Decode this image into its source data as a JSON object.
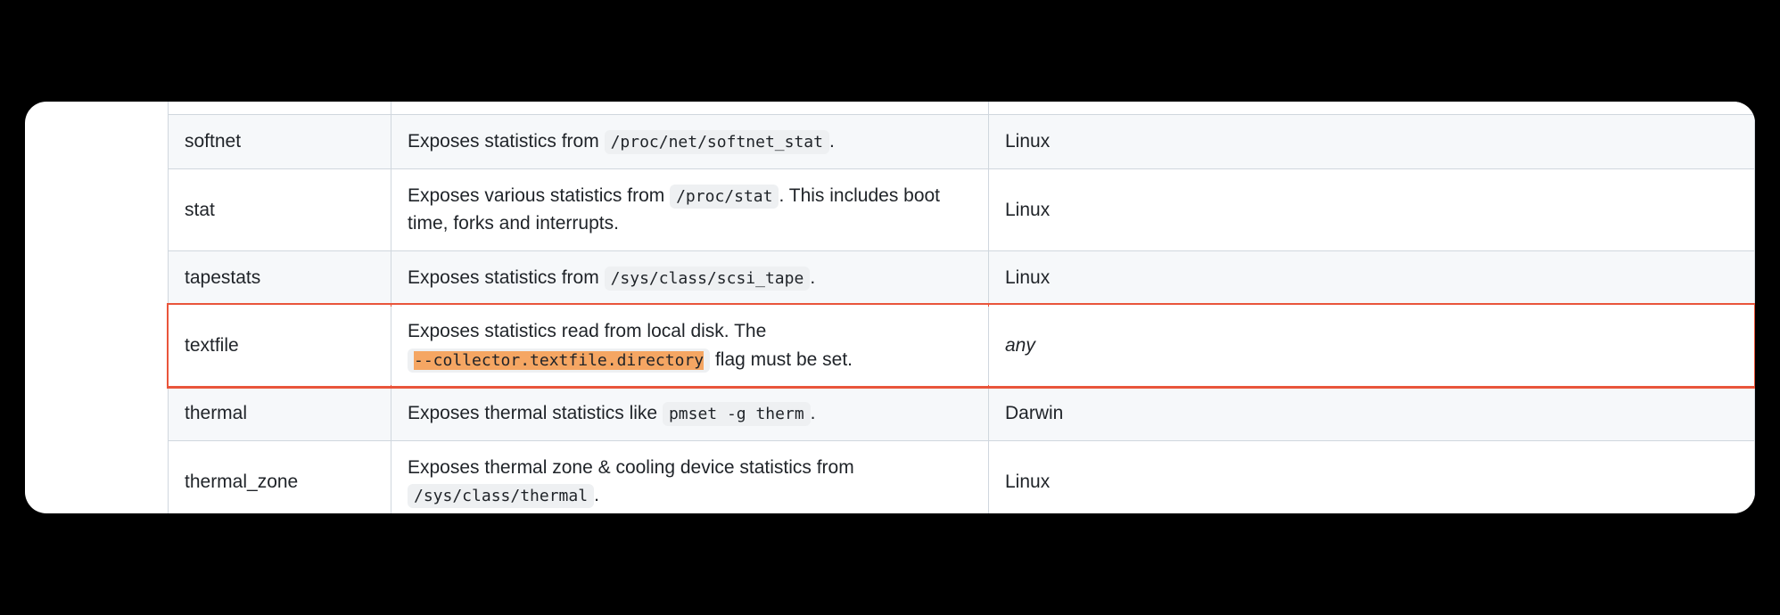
{
  "table": {
    "rows": [
      {
        "name": "softnet",
        "desc_prefix": "Exposes statistics from ",
        "code": "/proc/net/softnet_stat",
        "desc_suffix": ".",
        "os": "Linux"
      },
      {
        "name": "stat",
        "desc_prefix": "Exposes various statistics from ",
        "code": "/proc/stat",
        "desc_suffix": ". This includes boot time, forks and interrupts.",
        "os": "Linux"
      },
      {
        "name": "tapestats",
        "desc_prefix": "Exposes statistics from ",
        "code": "/sys/class/scsi_tape",
        "desc_suffix": ".",
        "os": "Linux"
      },
      {
        "name": "textfile",
        "desc_prefix": "Exposes statistics read from local disk. The ",
        "code": "--collector.textfile.directory",
        "desc_suffix": " flag must be set.",
        "os": "any",
        "highlighted": true
      },
      {
        "name": "thermal",
        "desc_prefix": "Exposes thermal statistics like ",
        "code": "pmset -g therm",
        "desc_suffix": ".",
        "os": "Darwin"
      },
      {
        "name": "thermal_zone",
        "desc_prefix": "Exposes thermal zone & cooling device statistics from ",
        "code": "/sys/class/thermal",
        "desc_suffix": ".",
        "os": "Linux"
      }
    ]
  }
}
